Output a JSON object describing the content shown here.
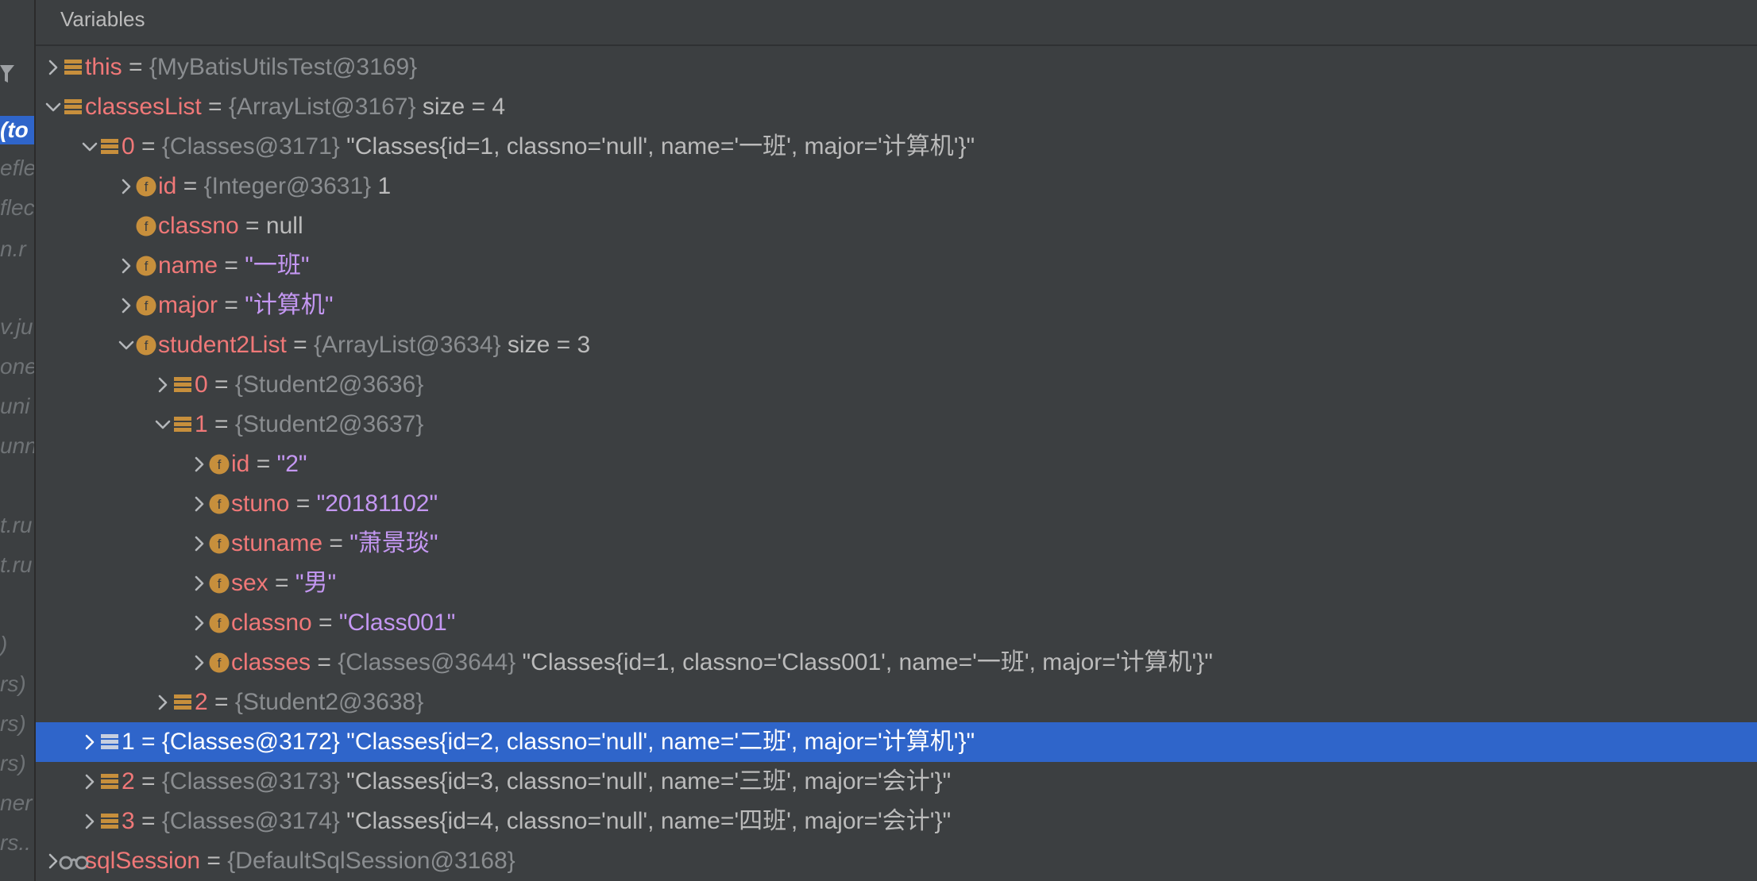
{
  "panel": {
    "title": "Variables"
  },
  "left_fragments": [
    "(to",
    "eflec",
    "flec",
    "n.r",
    "v.ju",
    "one",
    "uni",
    "unn",
    "t.ru",
    "t.ru",
    ")",
    "rs)",
    "rs)",
    "rs)",
    "ner",
    "rs.."
  ],
  "rows": [
    {
      "name": "this",
      "eq": " = ",
      "ref": "{MyBatisUtilsTest@3169}",
      "value": "",
      "extra": ""
    },
    {
      "name": "classesList",
      "eq": " = ",
      "ref": "{ArrayList@3167}",
      "value": "",
      "extra": "  size = 4"
    },
    {
      "name": "0",
      "eq": " = ",
      "ref": "{Classes@3171}",
      "value": " \"Classes{id=1, classno='null', name='一班', major='计算机'}\"",
      "extra": ""
    },
    {
      "name": "id",
      "eq": " = ",
      "ref": "{Integer@3631}",
      "value": " 1",
      "extra": ""
    },
    {
      "name": "classno",
      "eq": " = ",
      "ref": "",
      "value": "null",
      "extra": ""
    },
    {
      "name": "name",
      "eq": " = ",
      "ref": "",
      "value": "\"一班\"",
      "extra": ""
    },
    {
      "name": "major",
      "eq": " = ",
      "ref": "",
      "value": "\"计算机\"",
      "extra": ""
    },
    {
      "name": "student2List",
      "eq": " = ",
      "ref": "{ArrayList@3634}",
      "value": "",
      "extra": "  size = 3"
    },
    {
      "name": "0",
      "eq": " = ",
      "ref": "{Student2@3636}",
      "value": "",
      "extra": ""
    },
    {
      "name": "1",
      "eq": " = ",
      "ref": "{Student2@3637}",
      "value": "",
      "extra": ""
    },
    {
      "name": "id",
      "eq": " = ",
      "ref": "",
      "value": "\"2\"",
      "extra": ""
    },
    {
      "name": "stuno",
      "eq": " = ",
      "ref": "",
      "value": "\"20181102\"",
      "extra": ""
    },
    {
      "name": "stuname",
      "eq": " = ",
      "ref": "",
      "value": "\"萧景琰\"",
      "extra": ""
    },
    {
      "name": "sex",
      "eq": " = ",
      "ref": "",
      "value": "\"男\"",
      "extra": ""
    },
    {
      "name": "classno",
      "eq": " = ",
      "ref": "",
      "value": "\"Class001\"",
      "extra": ""
    },
    {
      "name": "classes",
      "eq": " = ",
      "ref": "{Classes@3644}",
      "value": " \"Classes{id=1, classno='Class001', name='一班', major='计算机'}\"",
      "extra": ""
    },
    {
      "name": "2",
      "eq": " = ",
      "ref": "{Student2@3638}",
      "value": "",
      "extra": ""
    },
    {
      "name": "1",
      "eq": " = ",
      "ref": "{Classes@3172}",
      "value": " \"Classes{id=2, classno='null', name='二班', major='计算机'}\"",
      "extra": ""
    },
    {
      "name": "2",
      "eq": " = ",
      "ref": "{Classes@3173}",
      "value": " \"Classes{id=3, classno='null', name='三班', major='会计'}\"",
      "extra": ""
    },
    {
      "name": "3",
      "eq": " = ",
      "ref": "{Classes@3174}",
      "value": " \"Classes{id=4, classno='null', name='四班', major='会计'}\"",
      "extra": ""
    },
    {
      "name": "sqlSession",
      "eq": " = ",
      "ref": "{DefaultSqlSession@3168}",
      "value": "",
      "extra": ""
    }
  ],
  "colors": {
    "background": "#3c3f41",
    "selection": "#2f65ca",
    "var_name": "#f07878",
    "string_value": "#c497f2",
    "object_ref": "#8a8d90",
    "field_icon": "#c78f3c"
  }
}
